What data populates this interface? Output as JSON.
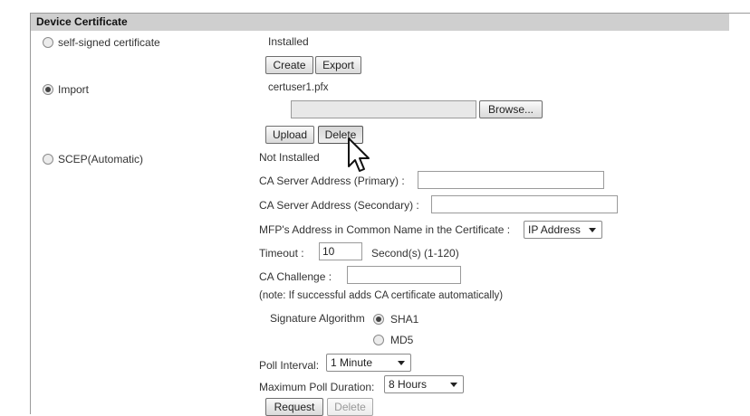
{
  "section": {
    "title": "Device Certificate"
  },
  "options": {
    "self_signed": {
      "label": "self-signed certificate",
      "status": "Installed",
      "selected": false
    },
    "import": {
      "label": "Import",
      "filename": "certuser1.pfx",
      "selected": true
    },
    "scep": {
      "label": "SCEP(Automatic)",
      "status": "Not Installed",
      "selected": false
    }
  },
  "buttons": {
    "create": "Create",
    "export": "Export",
    "browse": "Browse...",
    "upload": "Upload",
    "delete": "Delete",
    "request": "Request",
    "delete2": "Delete"
  },
  "file_input": {
    "value": ""
  },
  "scep_form": {
    "ca_primary_label": "CA Server Address (Primary) :",
    "ca_primary_value": "",
    "ca_secondary_label": "CA Server Address (Secondary) :",
    "ca_secondary_value": "",
    "mfp_label": "MFP's Address in Common Name in the Certificate :",
    "mfp_value": "IP Address",
    "timeout_label": "Timeout :",
    "timeout_value": "10",
    "timeout_unit": "Second(s) (1-120)",
    "ca_challenge_label": "CA Challenge :",
    "ca_challenge_value": "",
    "note": "(note: If successful adds CA certificate automatically)",
    "sig_label": "Signature Algorithm",
    "sig_sha1": "SHA1",
    "sig_md5": "MD5",
    "sig_selected": "SHA1",
    "poll_interval_label": "Poll Interval:",
    "poll_interval_value": "1 Minute",
    "max_poll_label": "Maximum Poll Duration:",
    "max_poll_value": "8 Hours"
  }
}
